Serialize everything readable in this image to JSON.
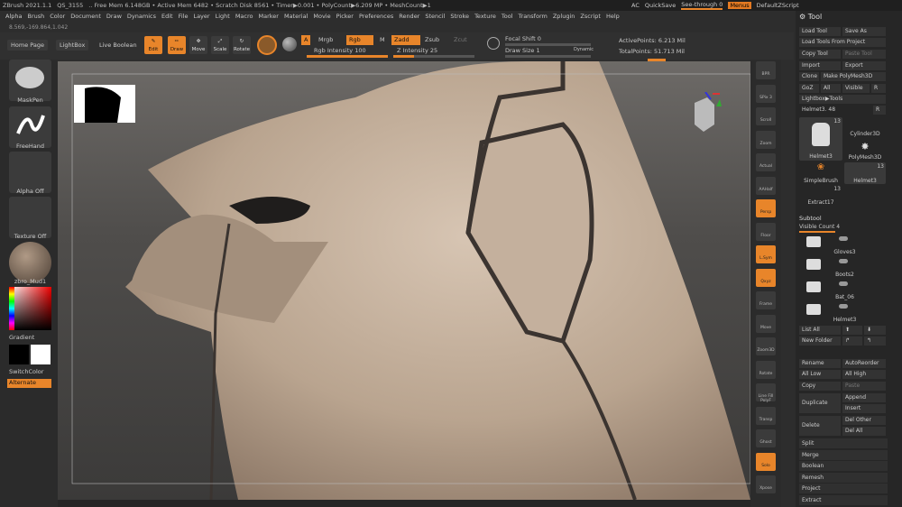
{
  "app": {
    "title": "ZBrush 2021.1.1"
  },
  "menubar": {
    "items": [
      "ZBrush 2021.1.1",
      "QS_3155",
      ".. Free Mem 6.148GB • Active Mem 6482 • Scratch Disk 8561 • Timer▶0.001 • PolyCount▶6.209 MP • MeshCount▶1",
      "AC",
      "QuickSave",
      "See-through 0",
      "Menus",
      "DefaultZScript"
    ],
    "menus": [
      "Alpha",
      "Brush",
      "Color",
      "Document",
      "Draw",
      "Dynamics",
      "Edit",
      "File",
      "Layer",
      "Light",
      "Macro",
      "Marker",
      "Material",
      "Movie",
      "Picker",
      "Preferences",
      "Render",
      "Stencil",
      "Stroke",
      "Texture",
      "Tool",
      "Transform",
      "Zplugin",
      "Zscript",
      "Help"
    ]
  },
  "coords": "8.569,-169.864,1.042",
  "toolbar": {
    "home": "Home Page",
    "lightbox": "LightBox",
    "liveboolean": "Live Boolean",
    "edit": "Edit",
    "draw": "Draw",
    "move": "Move",
    "scale": "Scale",
    "rotate": "Rotate",
    "a": "A",
    "mrgb": "Mrgb",
    "rgb": "Rgb",
    "m": "M",
    "zadd": "Zadd",
    "zsub": "Zsub",
    "zcut": "Zcut",
    "rgb_int": "Rgb Intensity 100",
    "z_int": "Z Intensity 25",
    "focal": "Focal Shift 0",
    "drawsize": "Draw Size 1",
    "dynamic": "Dynamic",
    "activepoints": "ActivePoints: 6.213 Mil",
    "totalpoints": "TotalPoints: 51.713 Mil",
    "rgb_val": 100,
    "z_val": 25
  },
  "leftshelf": {
    "brush": "MaskPen",
    "stroke": "FreeHand",
    "alpha": "Alpha Off",
    "texture": "Texture Off",
    "material": "zbro_Mud1",
    "gradient": "Gradient",
    "switchcolor": "SwitchColor",
    "alternate": "Alternate"
  },
  "rightshelf": [
    "BPR",
    "SPix 3",
    "Scroll",
    "Zoom",
    "Actual",
    "AAHalf",
    "Persp",
    "Floor",
    "L.Sym",
    "Qxyz",
    "Frame",
    "Move",
    "Zoom3D",
    "Rotate",
    "Line Fill PolyF",
    "Transp",
    "Ghost",
    "Solo",
    "Xpose"
  ],
  "toolpanel": {
    "title": "Tool",
    "loadtool": "Load Tool",
    "saveas": "Save As",
    "loadfromproject": "Load Tools From Project",
    "copytool": "Copy Tool",
    "pastetool": "Paste Tool",
    "import": "Import",
    "export": "Export",
    "clone": "Clone",
    "makepolymesh": "Make PolyMesh3D",
    "goz": "GoZ",
    "all": "All",
    "visible": "Visible",
    "r": "R",
    "lightboxtools": "Lightbox▶Tools",
    "current": "Helmet3. 48",
    "r2": "R",
    "tools": [
      {
        "label": "Helmet3",
        "count": "13"
      },
      {
        "label": "Cylinder3D",
        "count": ""
      },
      {
        "label": "PolyMesh3D",
        "count": ""
      },
      {
        "label": "SimpleBrush",
        "count": ""
      },
      {
        "label": "Helmet3",
        "count": "13"
      },
      {
        "label": "Extract17",
        "count": "13"
      }
    ],
    "subtool": "Subtool",
    "visiblecount": "Visible Count 4",
    "subtools": [
      "Gloves3",
      "Boots2",
      "Bat_06",
      "Helmet3"
    ],
    "listall": "List All",
    "newfolder": "New Folder",
    "rename": "Rename",
    "autoreorder": "AutoReorder",
    "alllow": "All Low",
    "allhigh": "All High",
    "copy": "Copy",
    "paste": "Paste",
    "duplicate": "Duplicate",
    "append": "Append",
    "insert": "Insert",
    "delete": "Delete",
    "delother": "Del Other",
    "delall": "Del All",
    "sections": [
      "Split",
      "Merge",
      "Boolean",
      "Remesh",
      "Project",
      "Extract"
    ]
  }
}
